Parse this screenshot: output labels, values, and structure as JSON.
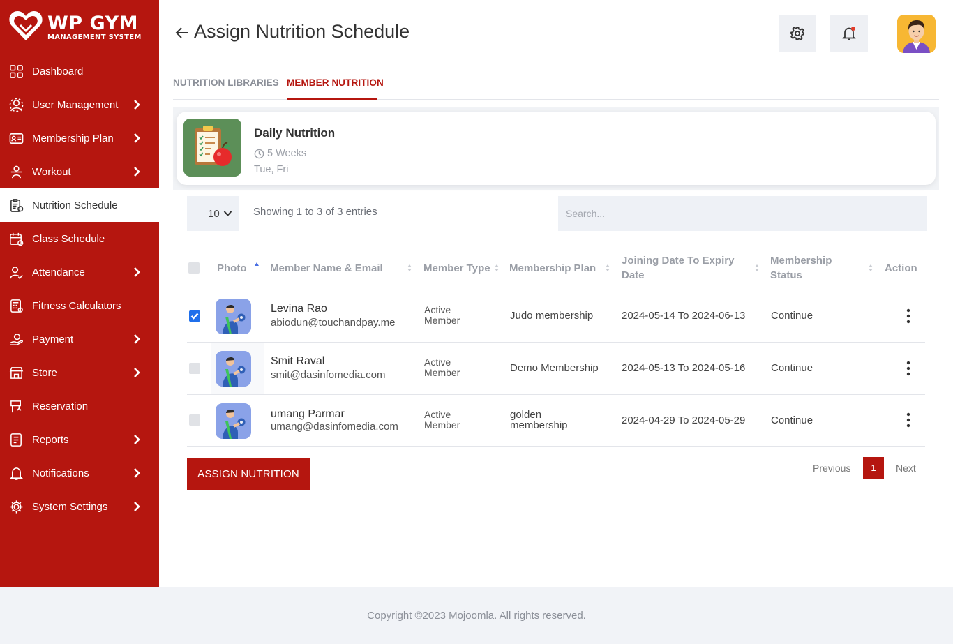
{
  "brand": {
    "title": "WP GYM",
    "subtitle": "MANAGEMENT SYSTEM",
    "accent": "#b5160f"
  },
  "sidebar": {
    "items": [
      {
        "label": "Dashboard",
        "icon": "grid-icon",
        "chevron": false,
        "active": false
      },
      {
        "label": "User Management",
        "icon": "users-gear-icon",
        "chevron": true,
        "active": false
      },
      {
        "label": "Membership Plan",
        "icon": "id-card-icon",
        "chevron": true,
        "active": false
      },
      {
        "label": "Workout",
        "icon": "dumbbell-person-icon",
        "chevron": true,
        "active": false
      },
      {
        "label": "Nutrition Schedule",
        "icon": "nutrition-clipboard-icon",
        "chevron": false,
        "active": true
      },
      {
        "label": "Class Schedule",
        "icon": "calendar-icon",
        "chevron": false,
        "active": false
      },
      {
        "label": "Attendance",
        "icon": "user-check-icon",
        "chevron": true,
        "active": false
      },
      {
        "label": "Fitness Calculators",
        "icon": "calculator-icon",
        "chevron": false,
        "active": false
      },
      {
        "label": "Payment",
        "icon": "hand-money-icon",
        "chevron": true,
        "active": false
      },
      {
        "label": "Store",
        "icon": "store-icon",
        "chevron": true,
        "active": false
      },
      {
        "label": "Reservation",
        "icon": "reservation-icon",
        "chevron": false,
        "active": false
      },
      {
        "label": "Reports",
        "icon": "report-icon",
        "chevron": true,
        "active": false
      },
      {
        "label": "Notifications",
        "icon": "bell-icon",
        "chevron": true,
        "active": false
      },
      {
        "label": "System Settings",
        "icon": "gear-icon",
        "chevron": true,
        "active": false
      }
    ]
  },
  "header": {
    "title": "Assign Nutrition Schedule"
  },
  "tabs": [
    {
      "label": "NUTRITION LIBRARIES",
      "active": false
    },
    {
      "label": "MEMBER NUTRITION",
      "active": true
    }
  ],
  "card": {
    "title": "Daily Nutrition",
    "duration": "5 Weeks",
    "days": "Tue, Fri"
  },
  "controls": {
    "page_size": "10",
    "entries_info": "Showing 1 to 3 of 3 entries",
    "search_placeholder": "Search..."
  },
  "table": {
    "headers": {
      "photo": "Photo",
      "member": "Member Name & Email",
      "type": "Member Type",
      "plan": "Membership Plan",
      "date_line1": "Joining Date To Expiry",
      "date_line2": "Date",
      "status_line1": "Membership",
      "status_line2": "Status",
      "action": "Action"
    },
    "rows": [
      {
        "checked": true,
        "name": "Levina Rao",
        "email": "abiodun@touchandpay.me",
        "type_line1": "Active",
        "type_line2": "Member",
        "plan_line1": "Judo membership",
        "plan_line2": "",
        "dates": "2024-05-14 To 2024-06-13",
        "status": "Continue"
      },
      {
        "checked": false,
        "name": "Smit Raval",
        "email": "smit@dasinfomedia.com",
        "type_line1": "Active",
        "type_line2": "Member",
        "plan_line1": "Demo Membership",
        "plan_line2": "",
        "dates": "2024-05-13 To 2024-05-16",
        "status": "Continue"
      },
      {
        "checked": false,
        "name": "umang Parmar",
        "email": "umang@dasinfomedia.com",
        "type_line1": "Active",
        "type_line2": "Member",
        "plan_line1": "golden",
        "plan_line2": "membership",
        "dates": "2024-04-29 To 2024-05-29",
        "status": "Continue"
      }
    ]
  },
  "actions": {
    "assign_label": "ASSIGN NUTRITION"
  },
  "pagination": {
    "previous": "Previous",
    "current": "1",
    "next": "Next"
  },
  "footer": {
    "copyright": "Copyright ©2023 Mojoomla. All rights reserved."
  }
}
